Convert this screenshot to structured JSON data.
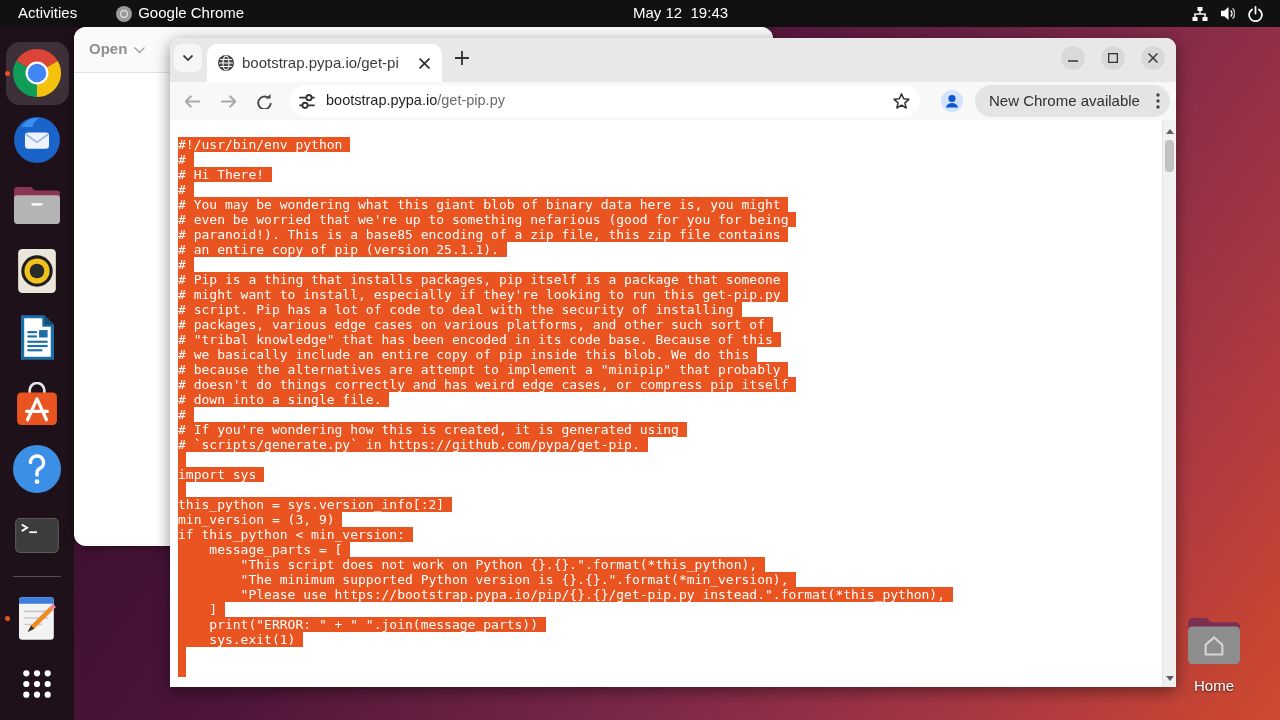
{
  "top_bar": {
    "activities": "Activities",
    "app_menu": "Google Chrome",
    "clock": "May 12  19:43"
  },
  "dock": {
    "favorites": [
      {
        "kind": "browser",
        "running": true,
        "selected": true
      },
      {
        "kind": "mail",
        "running": false,
        "selected": false
      },
      {
        "kind": "files",
        "running": false,
        "selected": false
      },
      {
        "kind": "music",
        "running": false,
        "selected": false
      },
      {
        "kind": "writer",
        "running": false,
        "selected": false
      },
      {
        "kind": "store",
        "running": false,
        "selected": false
      },
      {
        "kind": "help",
        "running": false,
        "selected": false
      },
      {
        "kind": "terminal",
        "running": false,
        "selected": false
      }
    ],
    "others": [
      {
        "kind": "editor",
        "running": true,
        "selected": false
      }
    ]
  },
  "background_window": {
    "menu_button": "Open"
  },
  "browser": {
    "tabs": [
      {
        "title": "bootstrap.pypa.io/get-pi",
        "selected": true
      }
    ],
    "back": {
      "disabled": true
    },
    "forward": {
      "disabled": true
    },
    "address": {
      "host": "bootstrap.pypa.io",
      "path": "/get-pip.py"
    },
    "update_button": "New Chrome available",
    "page": {
      "selected": true,
      "lines": [
        {
          "kind": "code",
          "text": "#!/usr/bin/env python"
        },
        {
          "kind": "code",
          "text": "#"
        },
        {
          "kind": "code",
          "text": "# Hi There!"
        },
        {
          "kind": "code",
          "text": "#"
        },
        {
          "kind": "code",
          "text": "# You may be wondering what this giant blob of binary data here is, you might"
        },
        {
          "kind": "code",
          "text": "# even be worried that we're up to something nefarious (good for you for being"
        },
        {
          "kind": "code",
          "text": "# paranoid!). This is a base85 encoding of a zip file, this zip file contains"
        },
        {
          "kind": "code",
          "text": "# an entire copy of pip (version 25.1.1)."
        },
        {
          "kind": "code",
          "text": "#"
        },
        {
          "kind": "code",
          "text": "# Pip is a thing that installs packages, pip itself is a package that someone"
        },
        {
          "kind": "code",
          "text": "# might want to install, especially if they're looking to run this get-pip.py"
        },
        {
          "kind": "code",
          "text": "# script. Pip has a lot of code to deal with the security of installing"
        },
        {
          "kind": "code",
          "text": "# packages, various edge cases on various platforms, and other such sort of"
        },
        {
          "kind": "code",
          "text": "# \"tribal knowledge\" that has been encoded in its code base. Because of this"
        },
        {
          "kind": "code",
          "text": "# we basically include an entire copy of pip inside this blob. We do this"
        },
        {
          "kind": "code",
          "text": "# because the alternatives are attempt to implement a \"minipip\" that probably"
        },
        {
          "kind": "code",
          "text": "# doesn't do things correctly and has weird edge cases, or compress pip itself"
        },
        {
          "kind": "code",
          "text": "# down into a single file."
        },
        {
          "kind": "code",
          "text": "#"
        },
        {
          "kind": "code",
          "text": "# If you're wondering how this is created, it is generated using"
        },
        {
          "kind": "code",
          "text": "# `scripts/generate.py` in https://github.com/pypa/get-pip."
        },
        {
          "kind": "blank"
        },
        {
          "kind": "code",
          "text": "import sys"
        },
        {
          "kind": "blank"
        },
        {
          "kind": "code",
          "text": "this_python = sys.version_info[:2]"
        },
        {
          "kind": "code",
          "text": "min_version = (3, 9)"
        },
        {
          "kind": "code",
          "text": "if this_python < min_version:"
        },
        {
          "kind": "code",
          "text": "    message_parts = ["
        },
        {
          "kind": "code",
          "text": "        \"This script does not work on Python {}.{}.\".format(*this_python),"
        },
        {
          "kind": "code",
          "text": "        \"The minimum supported Python version is {}.{}.\".format(*min_version),"
        },
        {
          "kind": "code",
          "text": "        \"Please use https://bootstrap.pypa.io/pip/{}.{}/get-pip.py instead.\".format(*this_python),"
        },
        {
          "kind": "code",
          "text": "    ]"
        },
        {
          "kind": "code",
          "text": "    print(\"ERROR: \" + \" \".join(message_parts))"
        },
        {
          "kind": "code",
          "text": "    sys.exit(1)"
        },
        {
          "kind": "blank"
        },
        {
          "kind": "blank"
        }
      ]
    }
  },
  "desktop_icons": [
    {
      "label": "Home"
    }
  ]
}
